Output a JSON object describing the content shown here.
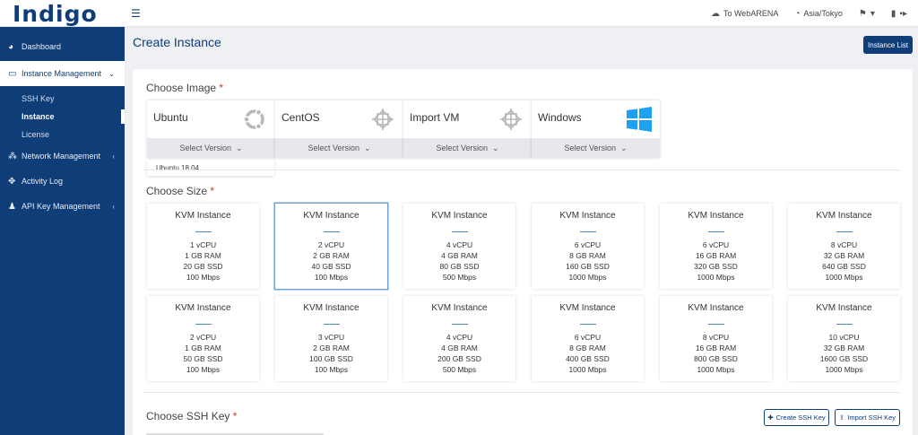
{
  "brand": "Indigo",
  "header": {
    "items": [
      {
        "icon": "cloud-arrow-icon",
        "label": "To WebARENA"
      },
      {
        "icon": "clock-icon",
        "label": "Asia/Tokyo"
      }
    ]
  },
  "sidebar": {
    "items": [
      {
        "label": "Dashboard"
      },
      {
        "label": "Instance Management"
      },
      {
        "label": "Network Management"
      },
      {
        "label": "Activity Log"
      },
      {
        "label": "API Key Management"
      }
    ],
    "subitems": [
      {
        "label": "SSH Key"
      },
      {
        "label": "Instance"
      },
      {
        "label": "License"
      }
    ]
  },
  "page": {
    "title": "Create Instance",
    "instance_list_label": "Instance List"
  },
  "images": {
    "title": "Choose Image",
    "required_mark": "*",
    "select_label": "Select Version",
    "cards": [
      {
        "name": "Ubuntu",
        "logo": "ubuntu-logo-icon"
      },
      {
        "name": "CentOS",
        "logo": "centos-logo-icon"
      },
      {
        "name": "Import VM",
        "logo": "import-vm-logo-icon"
      },
      {
        "name": "Windows",
        "logo": "windows-logo-icon"
      }
    ],
    "dropdown_option": "Ubuntu 18.04"
  },
  "sizes": {
    "title": "Choose Size",
    "required_mark": "*",
    "card_title": "KVM Instance",
    "cards": [
      {
        "vcpu": "1",
        "ram": "1 GB",
        "ssd": "20 GB",
        "net": "100"
      },
      {
        "vcpu": "2",
        "ram": "2 GB",
        "ssd": "40 GB",
        "net": "100"
      },
      {
        "vcpu": "4",
        "ram": "4 GB",
        "ssd": "80 GB",
        "net": "500"
      },
      {
        "vcpu": "6",
        "ram": "8 GB",
        "ssd": "160 GB",
        "net": "1000"
      },
      {
        "vcpu": "6",
        "ram": "16 GB",
        "ssd": "320 GB",
        "net": "1000"
      },
      {
        "vcpu": "8",
        "ram": "32 GB",
        "ssd": "640 GB",
        "net": "1000"
      },
      {
        "vcpu": "2",
        "ram": "1 GB",
        "ssd": "50 GB",
        "net": "100"
      },
      {
        "vcpu": "3",
        "ram": "2 GB",
        "ssd": "100 GB",
        "net": "100"
      },
      {
        "vcpu": "4",
        "ram": "4 GB",
        "ssd": "200 GB",
        "net": "500"
      },
      {
        "vcpu": "6",
        "ram": "8 GB",
        "ssd": "400 GB",
        "net": "1000"
      },
      {
        "vcpu": "8",
        "ram": "16 GB",
        "ssd": "800 GB",
        "net": "1000"
      },
      {
        "vcpu": "10",
        "ram": "32 GB",
        "ssd": "1600 GB",
        "net": "1000"
      }
    ],
    "selected_index": 1,
    "units": {
      "vcpu": "vCPU",
      "ram": "RAM",
      "ssd": "SSD",
      "net": "Mbps"
    }
  },
  "ssh": {
    "title": "Choose SSH Key",
    "required_mark": "*",
    "create_label": "Create SSH Key",
    "import_label": "Import SSH Key"
  },
  "colors": {
    "brand": "#0f3d78",
    "accent": "#4b86c9",
    "required": "#d0342c"
  }
}
